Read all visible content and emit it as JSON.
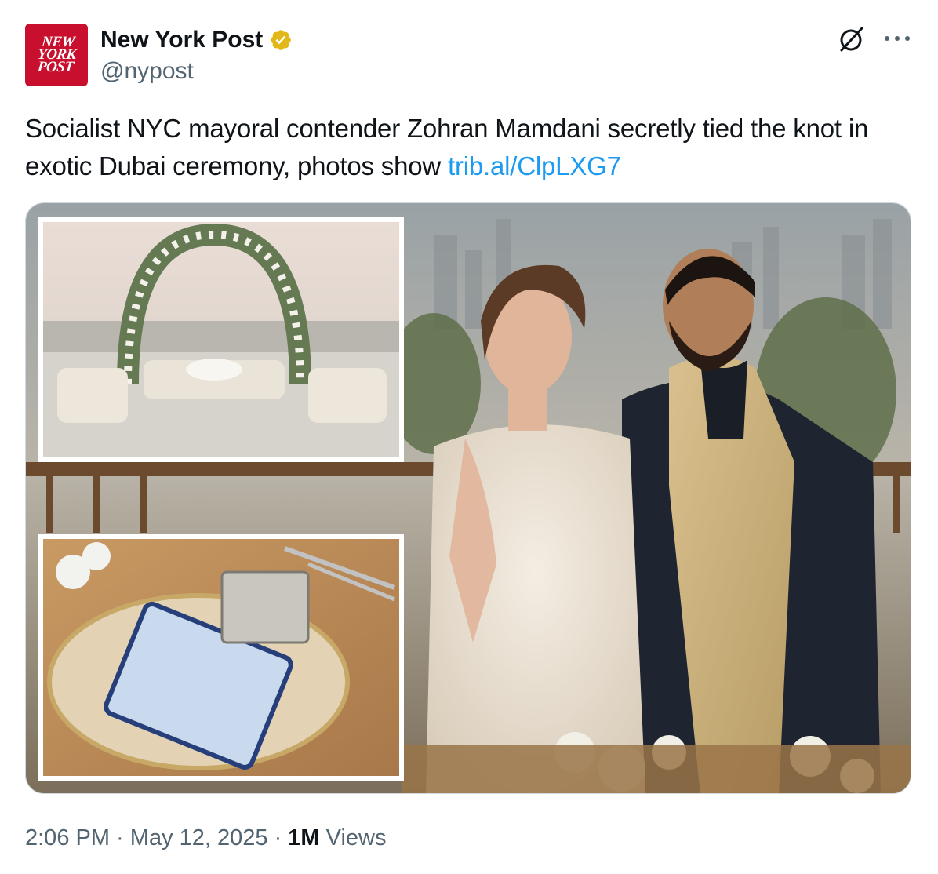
{
  "account": {
    "name": "New York Post",
    "handle": "@nypost",
    "avatar_logo_text": [
      "NEW",
      "YORK",
      "POST"
    ],
    "avatar_color": "#c8102e",
    "verified_badge_color": "#e2b719"
  },
  "icons": {
    "grok": "grok-icon",
    "more": "more-icon",
    "verified": "verified-badge-icon"
  },
  "tweet": {
    "text": "Socialist NYC mayoral contender Zohran Mamdani secretly tied the knot in exotic Dubai ceremony, photos show ",
    "link": "trib.al/ClpLXG7",
    "link_color": "#1d9bf0"
  },
  "media": {
    "description_panels": [
      "ceremony-arch-photo",
      "table-setting-photo",
      "couple-photo"
    ]
  },
  "footer": {
    "time": "2:06 PM",
    "separator": " · ",
    "date": "May 12, 2025",
    "views_count": "1M",
    "views_label": " Views"
  }
}
